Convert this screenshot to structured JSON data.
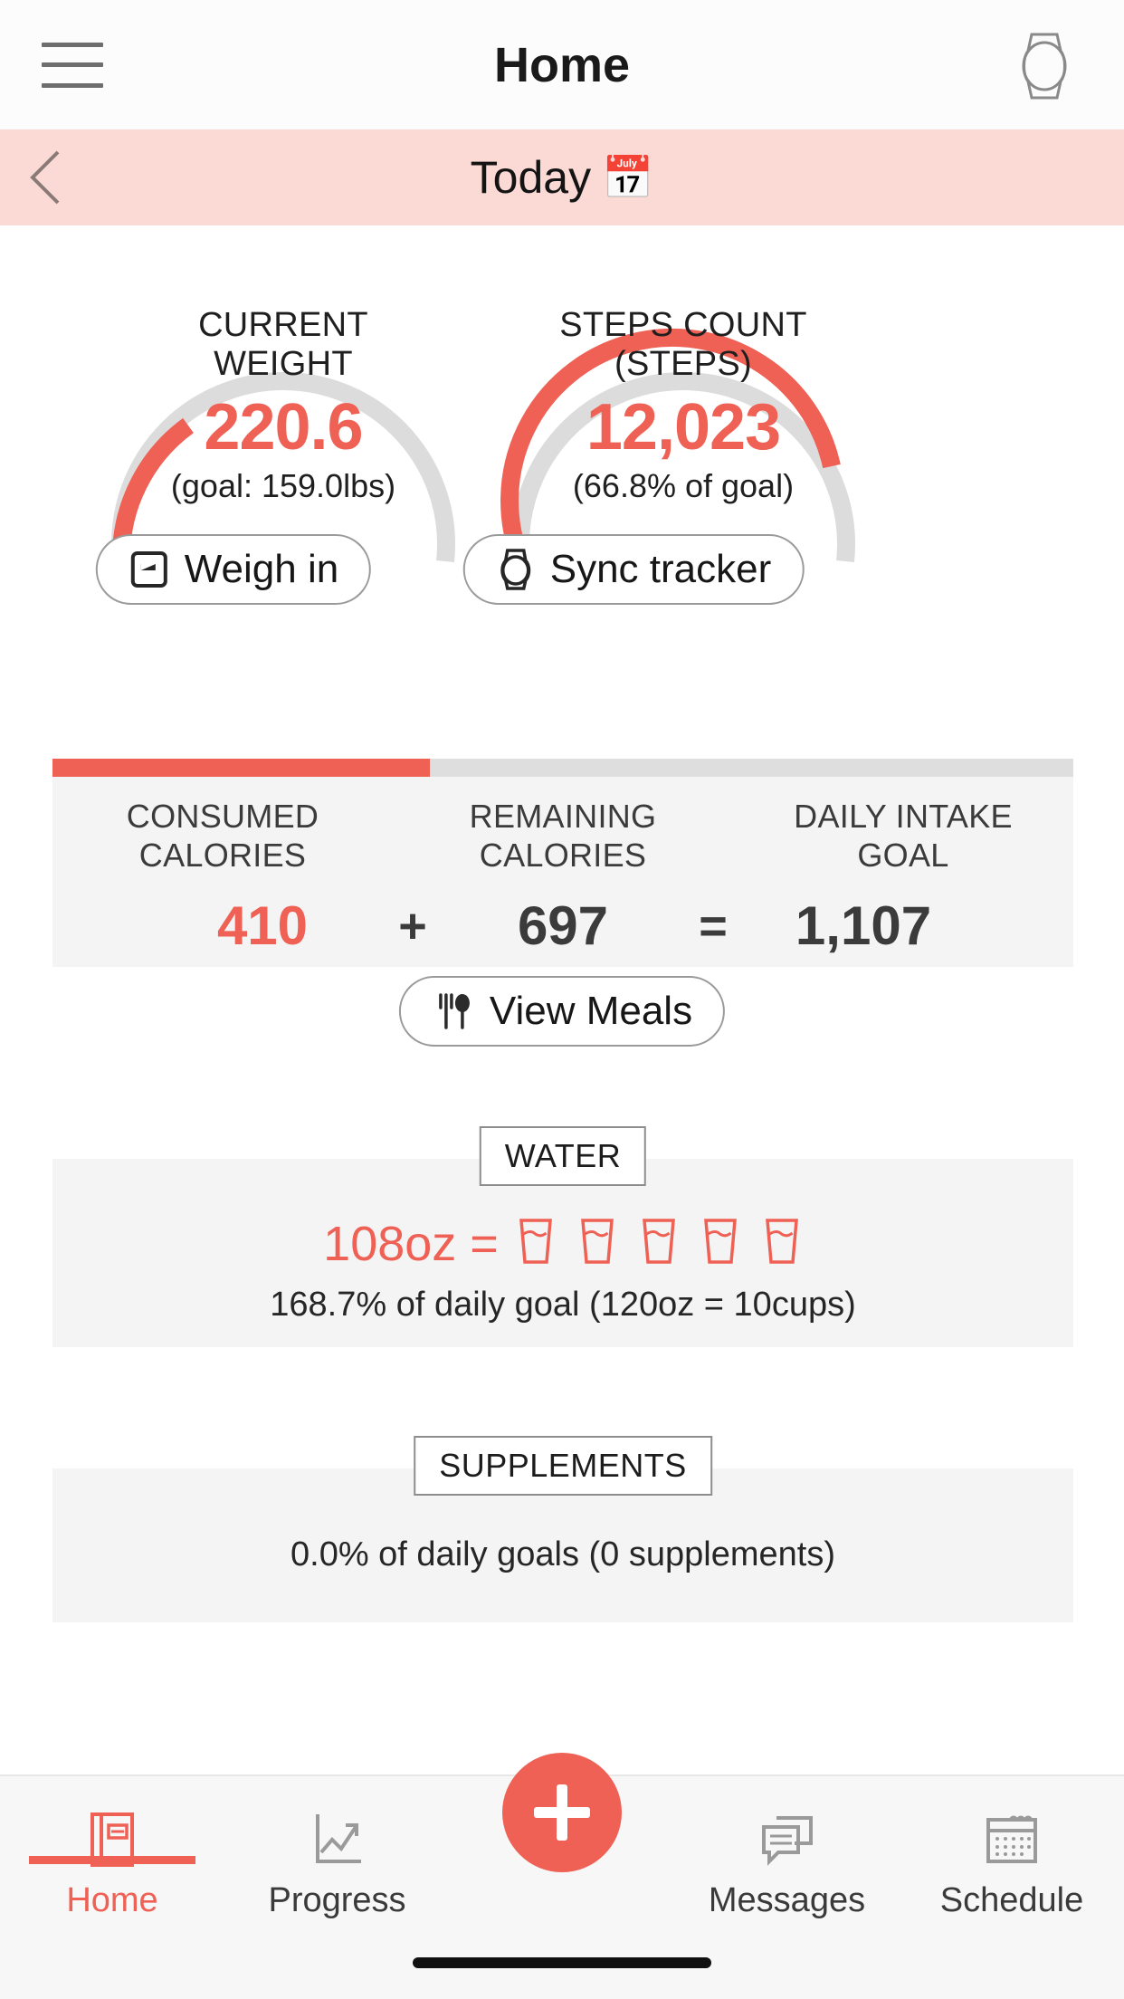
{
  "header": {
    "title": "Home",
    "menu_icon": "hamburger-menu-icon",
    "tracker_icon": "fitness-tracker-icon"
  },
  "datebar": {
    "label": "Today",
    "calendar_glyph": "📅",
    "back_icon": "chevron-left-icon",
    "background": "#fbd9d5"
  },
  "rings": [
    {
      "label": "CURRENT\nWEIGHT",
      "label_line1": "CURRENT",
      "label_line2": "WEIGHT",
      "value": "220.6",
      "sub": "(goal: 159.0lbs)",
      "progress_pct": 28,
      "button_label": "Weigh in",
      "button_icon": "scale-icon"
    },
    {
      "label_line1": "STEPS COUNT",
      "label_line2": "(STEPS)",
      "value": "12,023",
      "sub": "(66.8% of goal)",
      "progress_pct": 66.8,
      "button_label": "Sync tracker",
      "button_icon": "fitness-tracker-icon"
    }
  ],
  "calories": {
    "progress_pct": 37,
    "columns": [
      {
        "head_line1": "CONSUMED",
        "head_line2": "CALORIES",
        "value": "410",
        "accent": true
      },
      {
        "head_line1": "REMAINING",
        "head_line2": "CALORIES",
        "value": "697",
        "accent": false
      },
      {
        "head_line1": "DAILY INTAKE",
        "head_line2": "GOAL",
        "value": "1,107",
        "accent": false
      }
    ],
    "operator_plus": "+",
    "operator_equals": "=",
    "button_label": "View Meals",
    "button_icon": "fork-knife-icon"
  },
  "water": {
    "badge": "WATER",
    "amount": "108oz =",
    "glass_count": 5,
    "glass_icon": "water-glass-icon",
    "sub": "168.7% of daily goal (120oz = 10cups)"
  },
  "supplements": {
    "badge": "SUPPLEMENTS",
    "sub": "0.0% of daily goals (0 supplements)"
  },
  "bottom_nav": {
    "items": [
      {
        "label": "Home",
        "icon": "journal-book-icon",
        "active": true
      },
      {
        "label": "Progress",
        "icon": "line-chart-icon",
        "active": false
      },
      {
        "label": "Messages",
        "icon": "chat-bubbles-icon",
        "active": false
      },
      {
        "label": "Schedule",
        "icon": "calendar-icon",
        "active": false
      }
    ],
    "fab_icon": "plus-icon"
  },
  "colors": {
    "accent": "#ef6055",
    "pink_bar": "#fbd9d5",
    "card_bg": "#f4f4f4",
    "track_gray": "#dedede"
  }
}
